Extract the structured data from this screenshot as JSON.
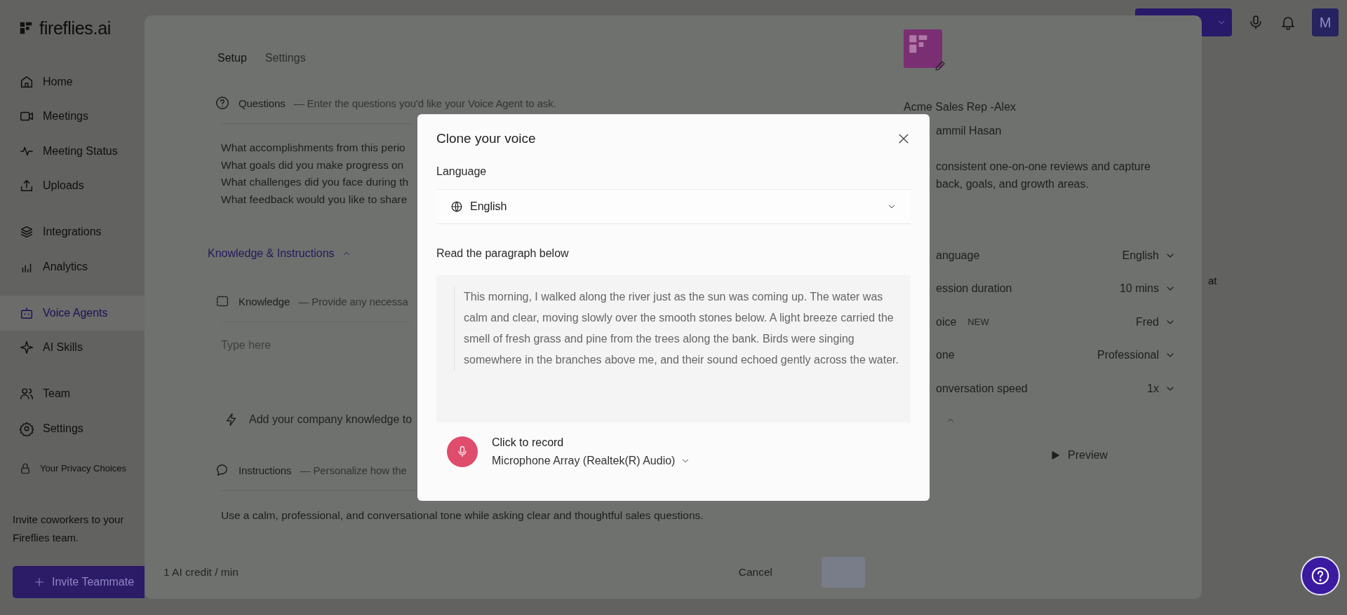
{
  "app": {
    "logo_text": "fireflies.ai",
    "avatar_initial": "M",
    "background_fragment": "at"
  },
  "sidebar": {
    "items": [
      {
        "label": "Home",
        "selected": false
      },
      {
        "label": "Meetings",
        "selected": false
      },
      {
        "label": "Meeting Status",
        "selected": false
      },
      {
        "label": "Uploads",
        "selected": false
      },
      {
        "label": "Integrations",
        "selected": false
      },
      {
        "label": "Analytics",
        "selected": false
      },
      {
        "label": "Voice Agents",
        "selected": true
      },
      {
        "label": "AI Skills",
        "selected": false
      },
      {
        "label": "Team",
        "selected": false
      },
      {
        "label": "Settings",
        "selected": false
      }
    ],
    "privacy_link": "Your Privacy Choices",
    "invite_text": "Invite coworkers to your Fireflies team.",
    "invite_button": "Invite Teammate"
  },
  "editor": {
    "tabs": [
      {
        "label": "Setup",
        "selected": true
      },
      {
        "label": "Settings",
        "selected": false
      }
    ],
    "questions": {
      "title": "Questions",
      "hint": "— Enter the questions you'd like your Voice Agent to ask.",
      "lines": [
        "What accomplishments from this perio",
        "What goals did you make progress on",
        "What challenges did you face during th",
        "What feedback would you like to share"
      ]
    },
    "section": {
      "label": "Knowledge & Instructions",
      "expanded": true
    },
    "knowledge": {
      "title": "Knowledge",
      "hint": "— Provide any necessa",
      "placeholder": "Type here",
      "add_prompt": "Add your company knowledge to"
    },
    "instructions": {
      "title": "Instructions",
      "hint": "— Personalize how the",
      "value": "Use a calm, professional, and conversational tone while asking clear and thoughtful sales questions."
    },
    "footer": {
      "credit": "1 AI credit / min",
      "cancel": "Cancel"
    }
  },
  "agent": {
    "name": "Acme Sales Rep -Alex",
    "owner": "ammil Hasan",
    "description_lines": [
      "consistent one-on-one reviews and capture",
      "back, goals, and growth areas."
    ],
    "settings": [
      {
        "label": "anguage",
        "value": "English"
      },
      {
        "label": "ession duration",
        "value": "10 mins"
      },
      {
        "label": "oice",
        "badge": "NEW",
        "value": "Fred"
      },
      {
        "label": "one",
        "value": "Professional"
      },
      {
        "label": "onversation speed",
        "value": "1x"
      }
    ],
    "advanced_expanded": true,
    "preview": "Preview"
  },
  "modal": {
    "title": "Clone your voice",
    "language_label": "Language",
    "language": "English",
    "paragraph_label": "Read the paragraph below",
    "paragraph": "This morning, I walked along the river just as the sun was coming up. The water was calm and clear, moving slowly over the smooth stones below. A light breeze carried the smell of fresh grass and pine from the trees along the bank. Birds were singing somewhere in the branches above me, and their sound echoed gently across the water.",
    "record_label": "Click to record",
    "microphone": "Microphone Array (Realtek(R) Audio)"
  }
}
